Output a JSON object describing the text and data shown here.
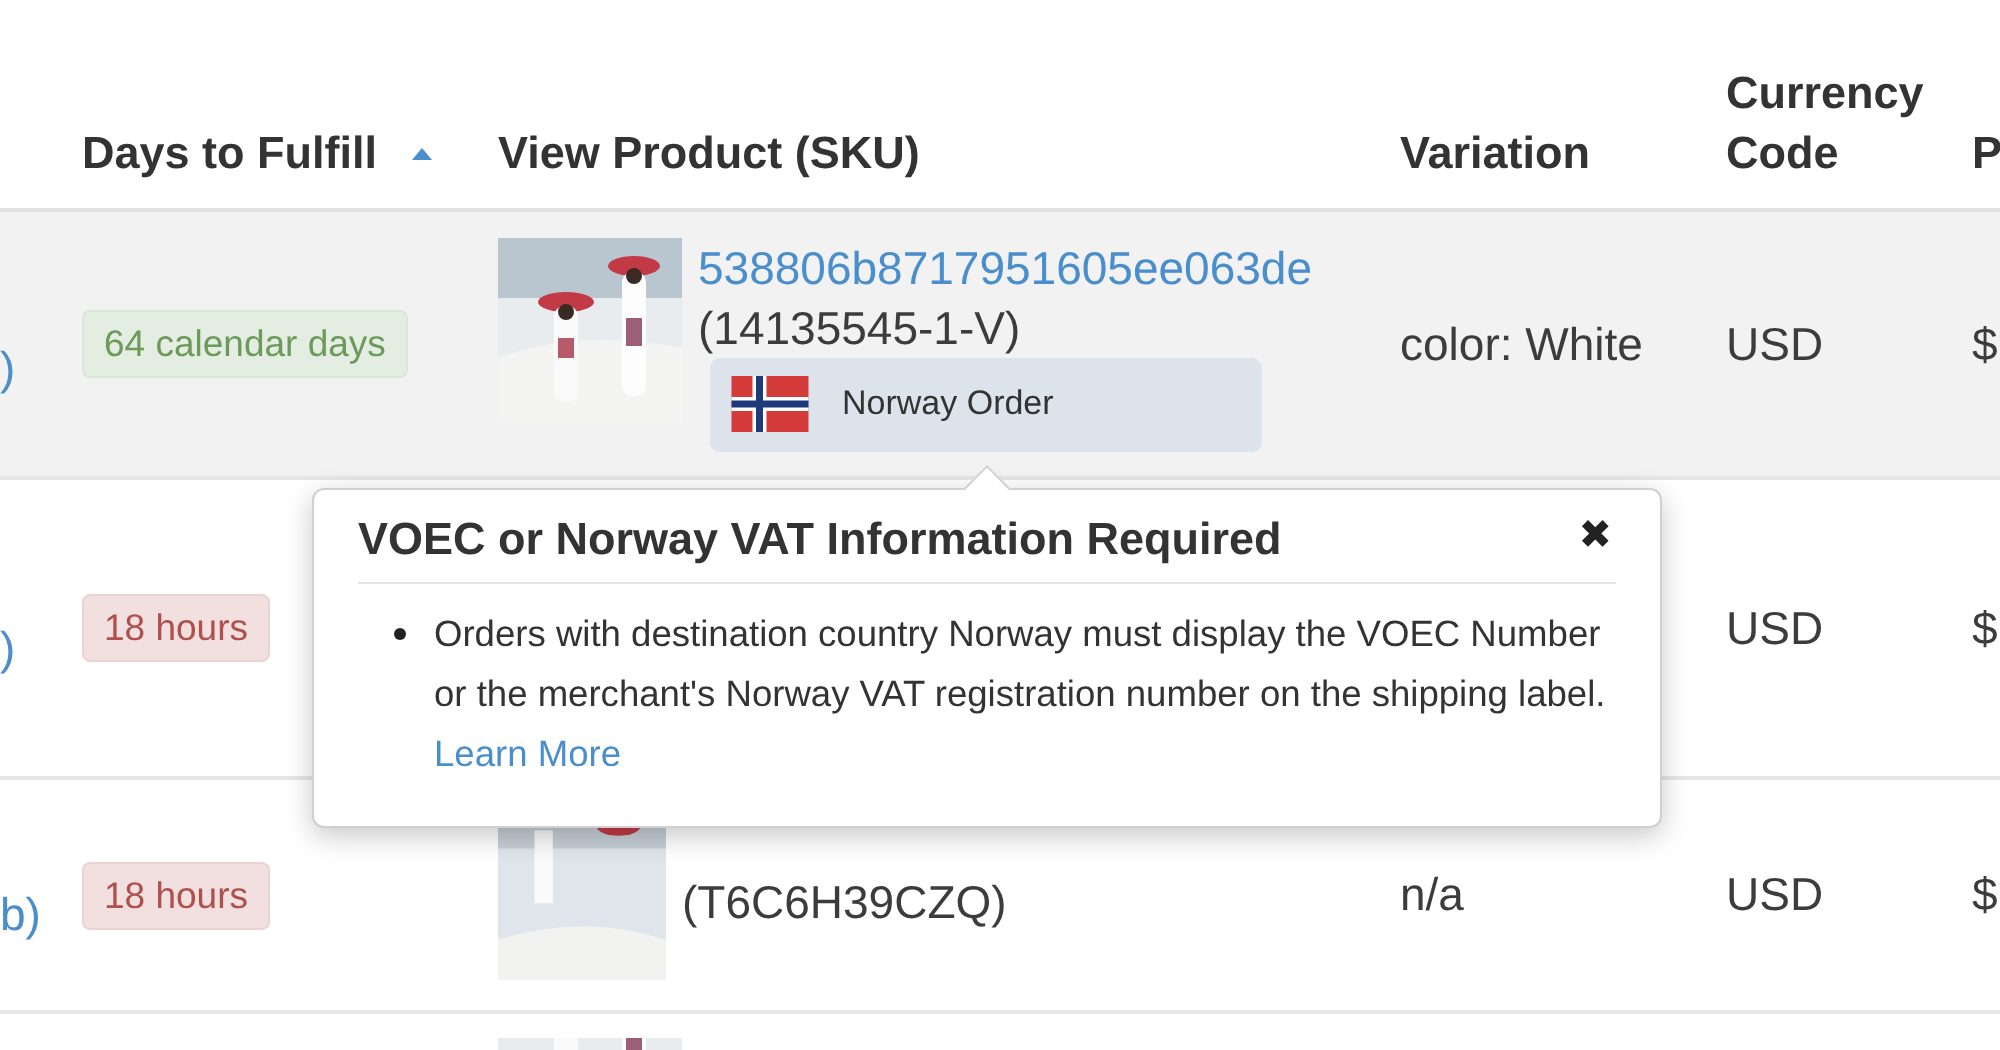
{
  "table": {
    "columns": [
      {
        "label": "Days to Fulfill",
        "sorted": true
      },
      {
        "label": "View Product (SKU)",
        "sorted": false
      },
      {
        "label": "Variation",
        "sorted": false
      },
      {
        "label": "Currency Code",
        "sorted": false
      },
      {
        "label": "P",
        "sorted": false
      }
    ],
    "rows": [
      {
        "highlighted": true,
        "column_1": ")",
        "days": {
          "text": "64 calendar days",
          "color": "#6b9a5b"
        },
        "product": {
          "sku_link": "538806b8717951605ee063de",
          "sku": "(14135545-1-V)",
          "badge": {
            "label": "Norway Order"
          }
        },
        "variation": "color: White",
        "currency": "USD",
        "column_6": "$"
      },
      {
        "highlighted": false,
        "column_1": ")",
        "days": {
          "text": "18 hours",
          "color": "#b0504d"
        },
        "currency": "USD",
        "column_6": "$"
      },
      {
        "highlighted": false,
        "column_1": "b)",
        "days": {
          "text": "18 hours",
          "color": "#b0504d"
        },
        "product": {
          "sku": "(T6C6H39CZQ)"
        },
        "variation": "n/a",
        "currency": "USD",
        "column_6": "$"
      },
      {
        "highlighted": false
      }
    ]
  },
  "popover": {
    "title": "VOEC or Norway VAT Information Required",
    "close": "✖",
    "items": [
      {
        "text": "Orders with destination country Norway must display the VOEC Number or the merchant's Norway VAT registration number on the shipping label.",
        "link": "Learn More"
      }
    ]
  }
}
